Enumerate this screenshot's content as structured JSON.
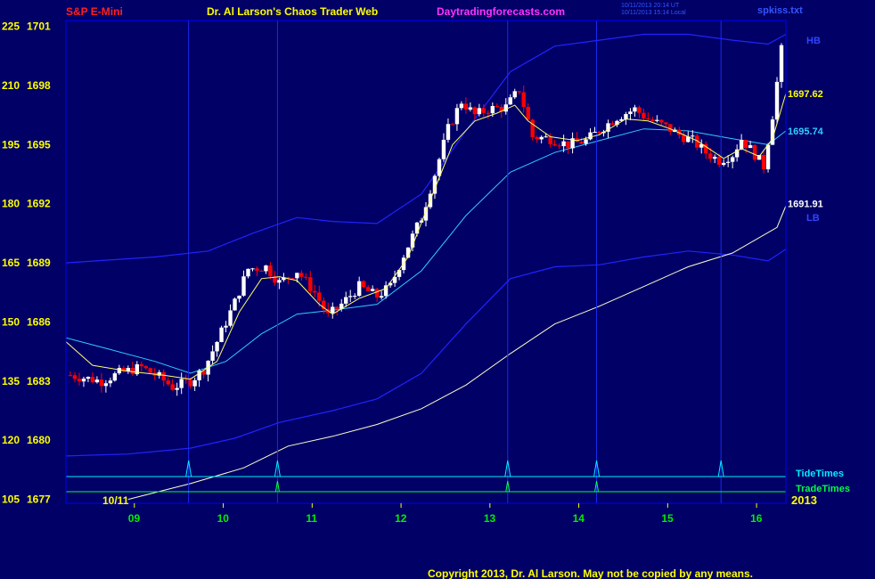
{
  "header": {
    "symbol": "S&P E-Mini",
    "title": "Dr. Al Larson's Chaos Trader Web",
    "site": "Daytradingforecasts.com",
    "stamp_utc": "10/11/2013 20:14 UT",
    "stamp_local": "10/11/2013 15:14 Local",
    "file": "spkiss.txt"
  },
  "footer": {
    "copyright": "Copyright 2013, Dr. Al Larson. May not be copied by any means."
  },
  "colors": {
    "background": "#000066",
    "plot_border": "#0000ff",
    "header_symbol": "#ff2020",
    "header_title": "#ffff00",
    "header_site": "#ff33ff",
    "axis_label": "#ffff00",
    "date_label": "#00ee00",
    "candle_up": "#ffffff",
    "candle_down": "#ff0000",
    "ma_fast": "#ffff66",
    "ma_mid": "#33ccff",
    "ma_slow": "#ffffcc",
    "band": "#2222ff",
    "tide": "#00eeff",
    "trade": "#00ff44"
  },
  "chart_data": {
    "type": "candlestick",
    "left_axis_ticks": [
      "225",
      "210",
      "195",
      "180",
      "165",
      "150",
      "135",
      "120",
      "105"
    ],
    "right_price_ticks": [
      "1701",
      "1698",
      "1695",
      "1692",
      "1689",
      "1686",
      "1683",
      "1680",
      "1677"
    ],
    "ylim": [
      1676.8,
      1701.3
    ],
    "x_ticks": [
      {
        "label": "09",
        "t": 0.77
      },
      {
        "label": "10",
        "t": 1.77
      },
      {
        "label": "11",
        "t": 2.77
      },
      {
        "label": "12",
        "t": 3.77
      },
      {
        "label": "13",
        "t": 4.77
      },
      {
        "label": "14",
        "t": 5.77
      },
      {
        "label": "15",
        "t": 6.77
      },
      {
        "label": "16",
        "t": 7.77
      }
    ],
    "x_range_hours": [
      8.0,
      16.1
    ],
    "date_label": "10/11",
    "year_label": "2013",
    "price_labels": [
      {
        "text": "HB",
        "value": 1700.3,
        "color": "#3344ff"
      },
      {
        "text": "1697.62",
        "value": 1697.6,
        "color": "#ffff00"
      },
      {
        "text": "1695.74",
        "value": 1695.7,
        "color": "#33ccff"
      },
      {
        "text": "1691.91",
        "value": 1692.0,
        "color": "#ffffff"
      },
      {
        "text": "LB",
        "value": 1691.3,
        "color": "#3344ff"
      }
    ],
    "vertical_time_lines": [
      9.38,
      10.38,
      12.97,
      13.97,
      15.37
    ],
    "tide_times": [
      9.38,
      10.38,
      12.97,
      13.97,
      15.37
    ],
    "trade_times": [
      10.38,
      12.97,
      13.97
    ],
    "tide_label": "TideTimes",
    "trade_label": "TradeTimes",
    "candle_anchors": [
      [
        8.05,
        1683.3
      ],
      [
        8.4,
        1683.0
      ],
      [
        8.6,
        1683.4
      ],
      [
        8.85,
        1683.7
      ],
      [
        9.05,
        1683.2
      ],
      [
        9.2,
        1682.7
      ],
      [
        9.4,
        1683.0
      ],
      [
        9.55,
        1683.6
      ],
      [
        9.7,
        1685.0
      ],
      [
        9.9,
        1687.0
      ],
      [
        10.05,
        1688.7
      ],
      [
        10.25,
        1688.8
      ],
      [
        10.4,
        1688.0
      ],
      [
        10.6,
        1688.6
      ],
      [
        10.8,
        1687.5
      ],
      [
        10.95,
        1686.3
      ],
      [
        11.1,
        1686.9
      ],
      [
        11.3,
        1687.8
      ],
      [
        11.5,
        1687.3
      ],
      [
        11.65,
        1687.8
      ],
      [
        11.8,
        1689.4
      ],
      [
        12.0,
        1691.3
      ],
      [
        12.15,
        1693.5
      ],
      [
        12.3,
        1695.8
      ],
      [
        12.45,
        1697.2
      ],
      [
        12.6,
        1696.5
      ],
      [
        12.75,
        1696.8
      ],
      [
        12.95,
        1696.9
      ],
      [
        13.1,
        1697.8
      ],
      [
        13.25,
        1695.4
      ],
      [
        13.45,
        1695.3
      ],
      [
        13.65,
        1695.0
      ],
      [
        13.85,
        1695.2
      ],
      [
        14.05,
        1695.9
      ],
      [
        14.2,
        1696.4
      ],
      [
        14.4,
        1696.8
      ],
      [
        14.55,
        1696.3
      ],
      [
        14.75,
        1695.9
      ],
      [
        14.9,
        1695.5
      ],
      [
        15.05,
        1695.2
      ],
      [
        15.2,
        1694.6
      ],
      [
        15.35,
        1694.2
      ],
      [
        15.5,
        1694.5
      ],
      [
        15.6,
        1695.3
      ],
      [
        15.75,
        1694.5
      ],
      [
        15.85,
        1693.9
      ],
      [
        15.95,
        1696.5
      ],
      [
        16.05,
        1699.8
      ]
    ],
    "ma_fast_pts": [
      [
        8.0,
        1685.0
      ],
      [
        8.3,
        1683.8
      ],
      [
        8.7,
        1683.5
      ],
      [
        9.1,
        1683.3
      ],
      [
        9.4,
        1683.1
      ],
      [
        9.7,
        1684.0
      ],
      [
        9.95,
        1686.5
      ],
      [
        10.2,
        1688.2
      ],
      [
        10.4,
        1688.3
      ],
      [
        10.6,
        1688.1
      ],
      [
        10.85,
        1686.9
      ],
      [
        11.0,
        1686.4
      ],
      [
        11.3,
        1687.2
      ],
      [
        11.6,
        1687.7
      ],
      [
        11.85,
        1689.3
      ],
      [
        12.1,
        1692.2
      ],
      [
        12.35,
        1695.0
      ],
      [
        12.6,
        1696.2
      ],
      [
        12.85,
        1696.6
      ],
      [
        13.05,
        1697.0
      ],
      [
        13.2,
        1696.2
      ],
      [
        13.45,
        1695.4
      ],
      [
        13.75,
        1695.2
      ],
      [
        14.0,
        1695.5
      ],
      [
        14.3,
        1696.3
      ],
      [
        14.55,
        1696.2
      ],
      [
        14.8,
        1695.8
      ],
      [
        15.1,
        1695.2
      ],
      [
        15.4,
        1694.3
      ],
      [
        15.6,
        1694.8
      ],
      [
        15.8,
        1694.4
      ],
      [
        15.95,
        1695.3
      ],
      [
        16.1,
        1697.6
      ]
    ],
    "ma_mid_pts": [
      [
        8.0,
        1685.2
      ],
      [
        8.5,
        1684.6
      ],
      [
        9.0,
        1684.0
      ],
      [
        9.4,
        1683.4
      ],
      [
        9.8,
        1684.0
      ],
      [
        10.2,
        1685.4
      ],
      [
        10.6,
        1686.4
      ],
      [
        11.0,
        1686.6
      ],
      [
        11.5,
        1686.9
      ],
      [
        12.0,
        1688.6
      ],
      [
        12.5,
        1691.4
      ],
      [
        13.0,
        1693.6
      ],
      [
        13.5,
        1694.6
      ],
      [
        14.0,
        1695.2
      ],
      [
        14.5,
        1695.8
      ],
      [
        15.0,
        1695.7
      ],
      [
        15.5,
        1695.3
      ],
      [
        15.9,
        1695.0
      ],
      [
        16.1,
        1695.7
      ]
    ],
    "ma_slow_pts": [
      [
        8.7,
        1677.0
      ],
      [
        9.4,
        1677.8
      ],
      [
        10.0,
        1678.6
      ],
      [
        10.5,
        1679.7
      ],
      [
        11.0,
        1680.2
      ],
      [
        11.5,
        1680.8
      ],
      [
        12.0,
        1681.6
      ],
      [
        12.5,
        1682.8
      ],
      [
        13.0,
        1684.4
      ],
      [
        13.5,
        1685.9
      ],
      [
        14.0,
        1686.8
      ],
      [
        14.5,
        1687.8
      ],
      [
        15.0,
        1688.8
      ],
      [
        15.5,
        1689.5
      ],
      [
        16.0,
        1690.8
      ],
      [
        16.1,
        1691.9
      ]
    ],
    "band_upper_pts": [
      [
        8.0,
        1689.0
      ],
      [
        9.0,
        1689.3
      ],
      [
        9.6,
        1689.6
      ],
      [
        10.1,
        1690.5
      ],
      [
        10.6,
        1691.3
      ],
      [
        11.0,
        1691.1
      ],
      [
        11.5,
        1691.0
      ],
      [
        12.0,
        1692.5
      ],
      [
        12.5,
        1695.7
      ],
      [
        13.0,
        1698.7
      ],
      [
        13.5,
        1700.0
      ],
      [
        14.0,
        1700.3
      ],
      [
        14.5,
        1700.6
      ],
      [
        15.0,
        1700.6
      ],
      [
        15.5,
        1700.3
      ],
      [
        15.9,
        1700.1
      ],
      [
        16.1,
        1700.6
      ]
    ],
    "band_lower_pts": [
      [
        8.0,
        1679.2
      ],
      [
        8.7,
        1679.3
      ],
      [
        9.4,
        1679.6
      ],
      [
        9.9,
        1680.1
      ],
      [
        10.4,
        1680.9
      ],
      [
        11.0,
        1681.5
      ],
      [
        11.5,
        1682.1
      ],
      [
        12.0,
        1683.4
      ],
      [
        12.5,
        1685.9
      ],
      [
        13.0,
        1688.2
      ],
      [
        13.5,
        1688.8
      ],
      [
        14.0,
        1688.9
      ],
      [
        14.5,
        1689.3
      ],
      [
        15.0,
        1689.6
      ],
      [
        15.5,
        1689.4
      ],
      [
        15.9,
        1689.1
      ],
      [
        16.1,
        1689.7
      ]
    ]
  }
}
